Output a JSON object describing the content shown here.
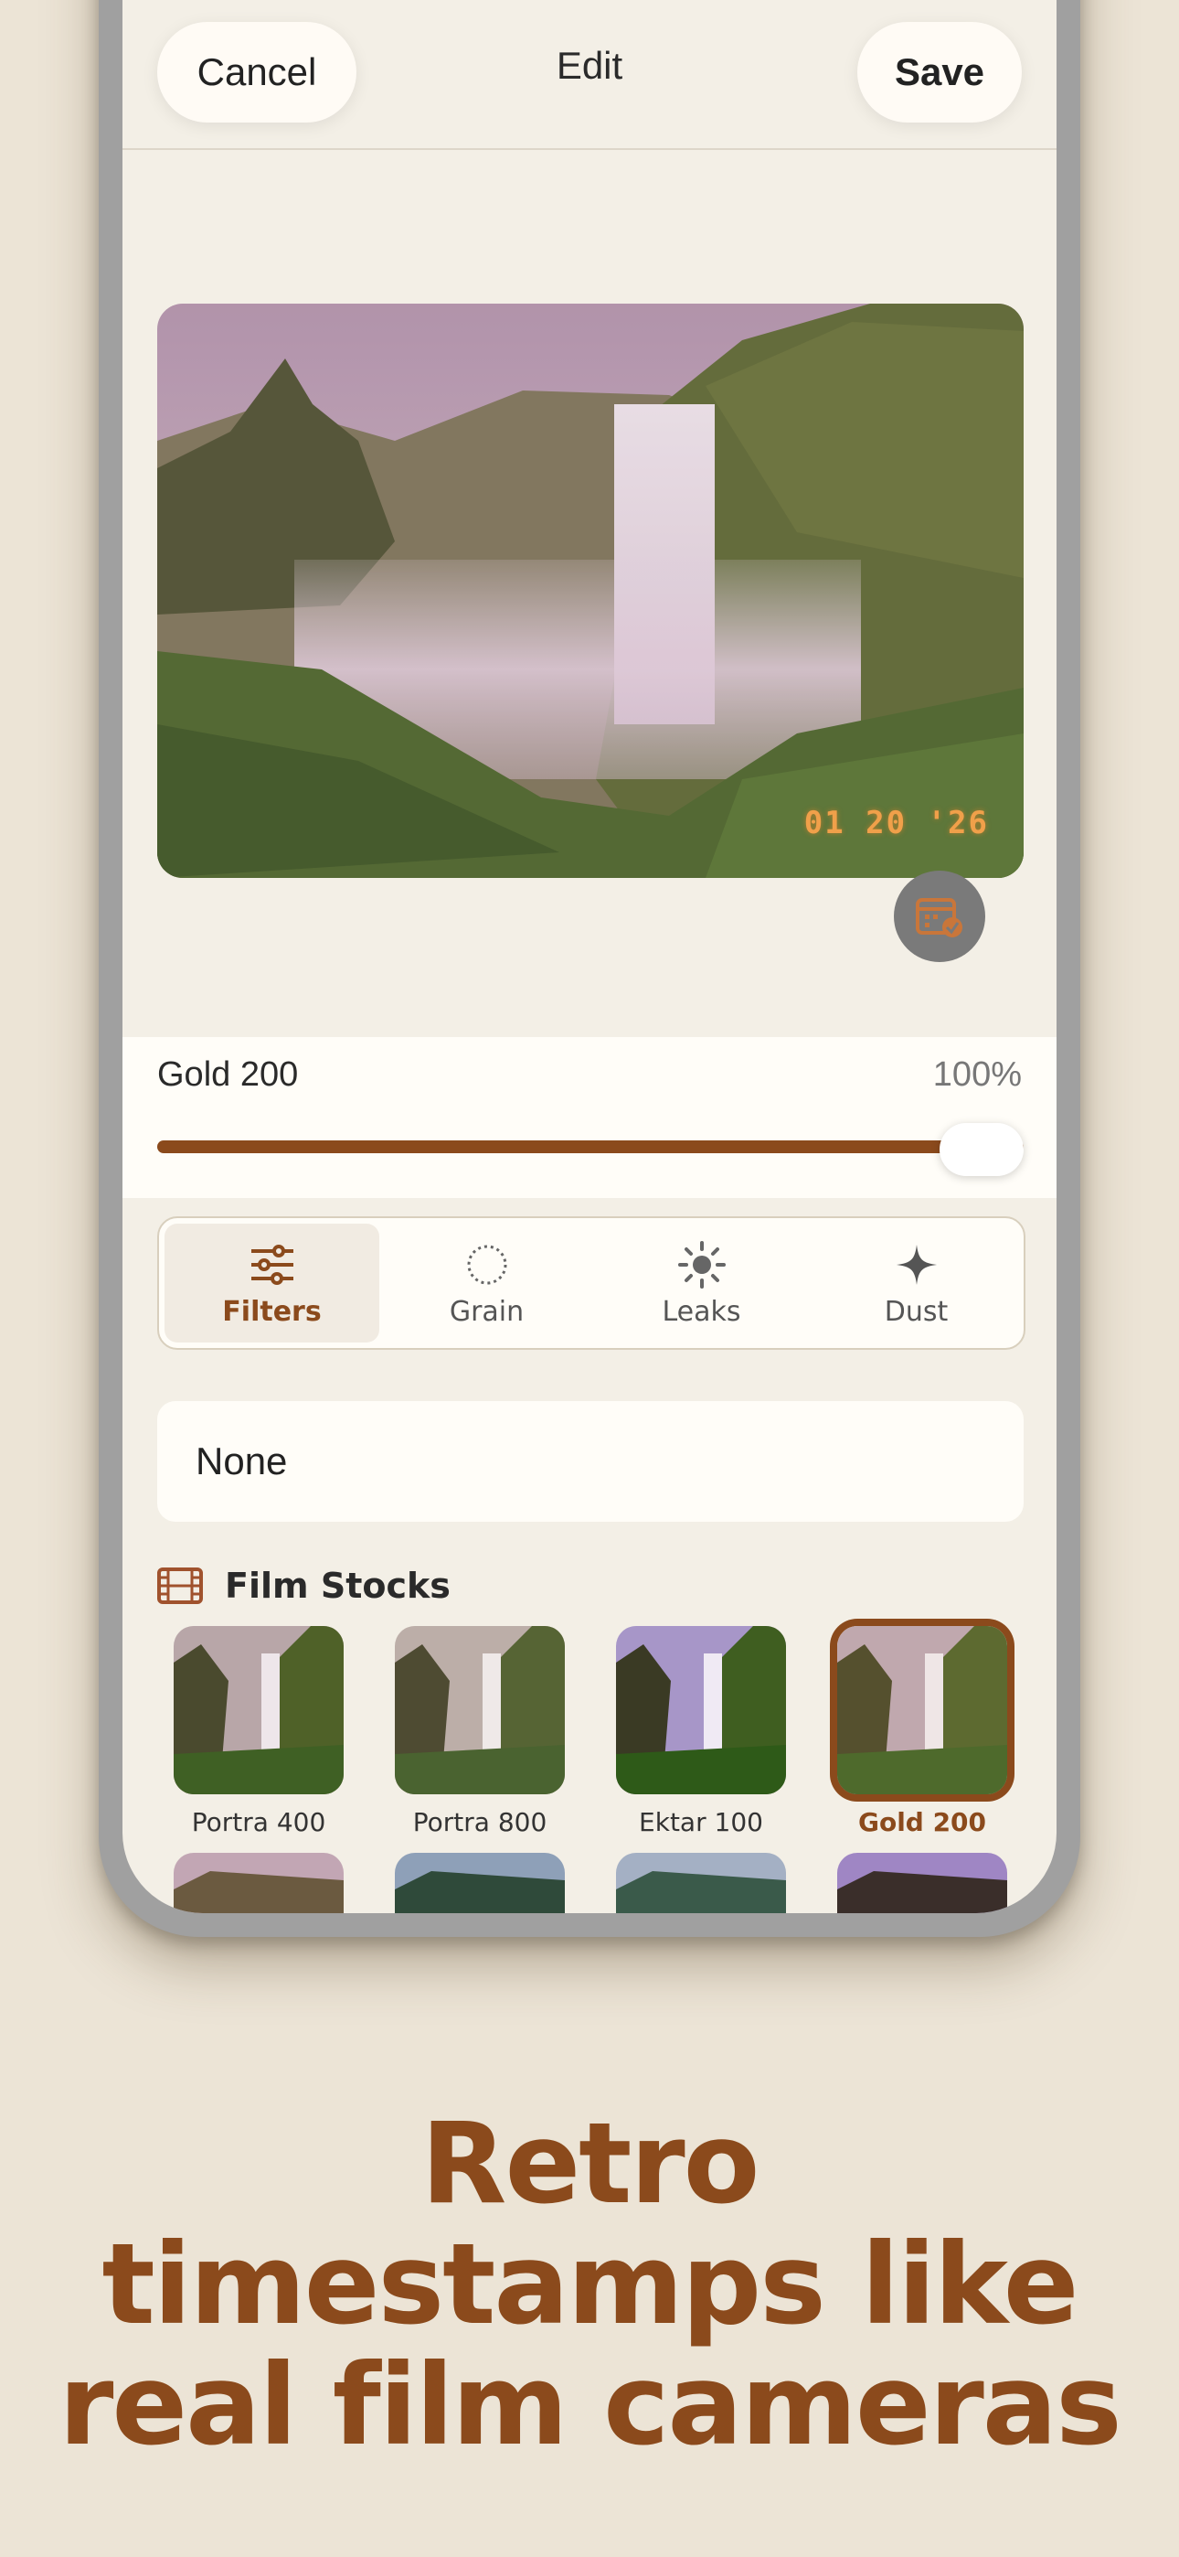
{
  "navbar": {
    "cancel": "Cancel",
    "title": "Edit",
    "save": "Save"
  },
  "photo": {
    "timestamp": "01 20 '26",
    "date_button_icon": "calendar-check-icon"
  },
  "adjust": {
    "filter_name": "Gold 200",
    "intensity": "100%",
    "intensity_fraction": 1.0
  },
  "tabs": [
    {
      "label": "Filters",
      "icon": "sliders-icon",
      "active": true
    },
    {
      "label": "Grain",
      "icon": "dotted-circle-icon",
      "active": false
    },
    {
      "label": "Leaks",
      "icon": "sun-icon",
      "active": false
    },
    {
      "label": "Dust",
      "icon": "sparkle-icon",
      "active": false
    }
  ],
  "none_option": "None",
  "section": {
    "title": "Film Stocks",
    "icon": "film-icon"
  },
  "film_stocks": [
    {
      "label": "Portra 400",
      "selected": false
    },
    {
      "label": "Portra 800",
      "selected": false
    },
    {
      "label": "Ektar 100",
      "selected": false
    },
    {
      "label": "Gold 200",
      "selected": true
    }
  ],
  "colors": {
    "accent": "#8b4a1c",
    "background": "#ece4d6",
    "timestamp": "#f0a04a"
  },
  "headline": {
    "line1": "Retro",
    "line2": "timestamps like",
    "line3": "real film cameras"
  }
}
